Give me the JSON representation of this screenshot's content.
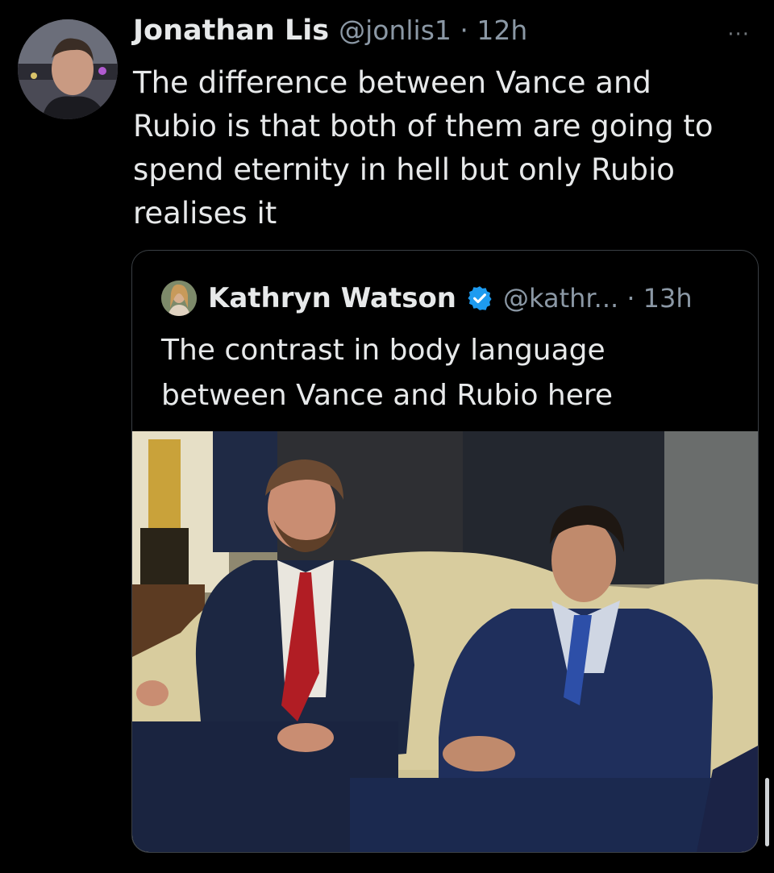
{
  "tweet": {
    "author_name": "Jonathan Lis",
    "handle": "@jonlis1 · 12h",
    "text": "The difference between Vance and\nRubio is that both of them are going to\nspend eternity in hell but only Rubio\nrealises it",
    "more_glyph": "···"
  },
  "quoted_tweet": {
    "author_name": "Kathryn Watson",
    "handle": "@kathr... · 13h",
    "text": "The contrast in body language\nbetween Vance and Rubio here"
  },
  "colors": {
    "background": "#000000",
    "text": "#e7e9ea",
    "muted": "#8b98a5",
    "verified": "#1d9bf0"
  }
}
